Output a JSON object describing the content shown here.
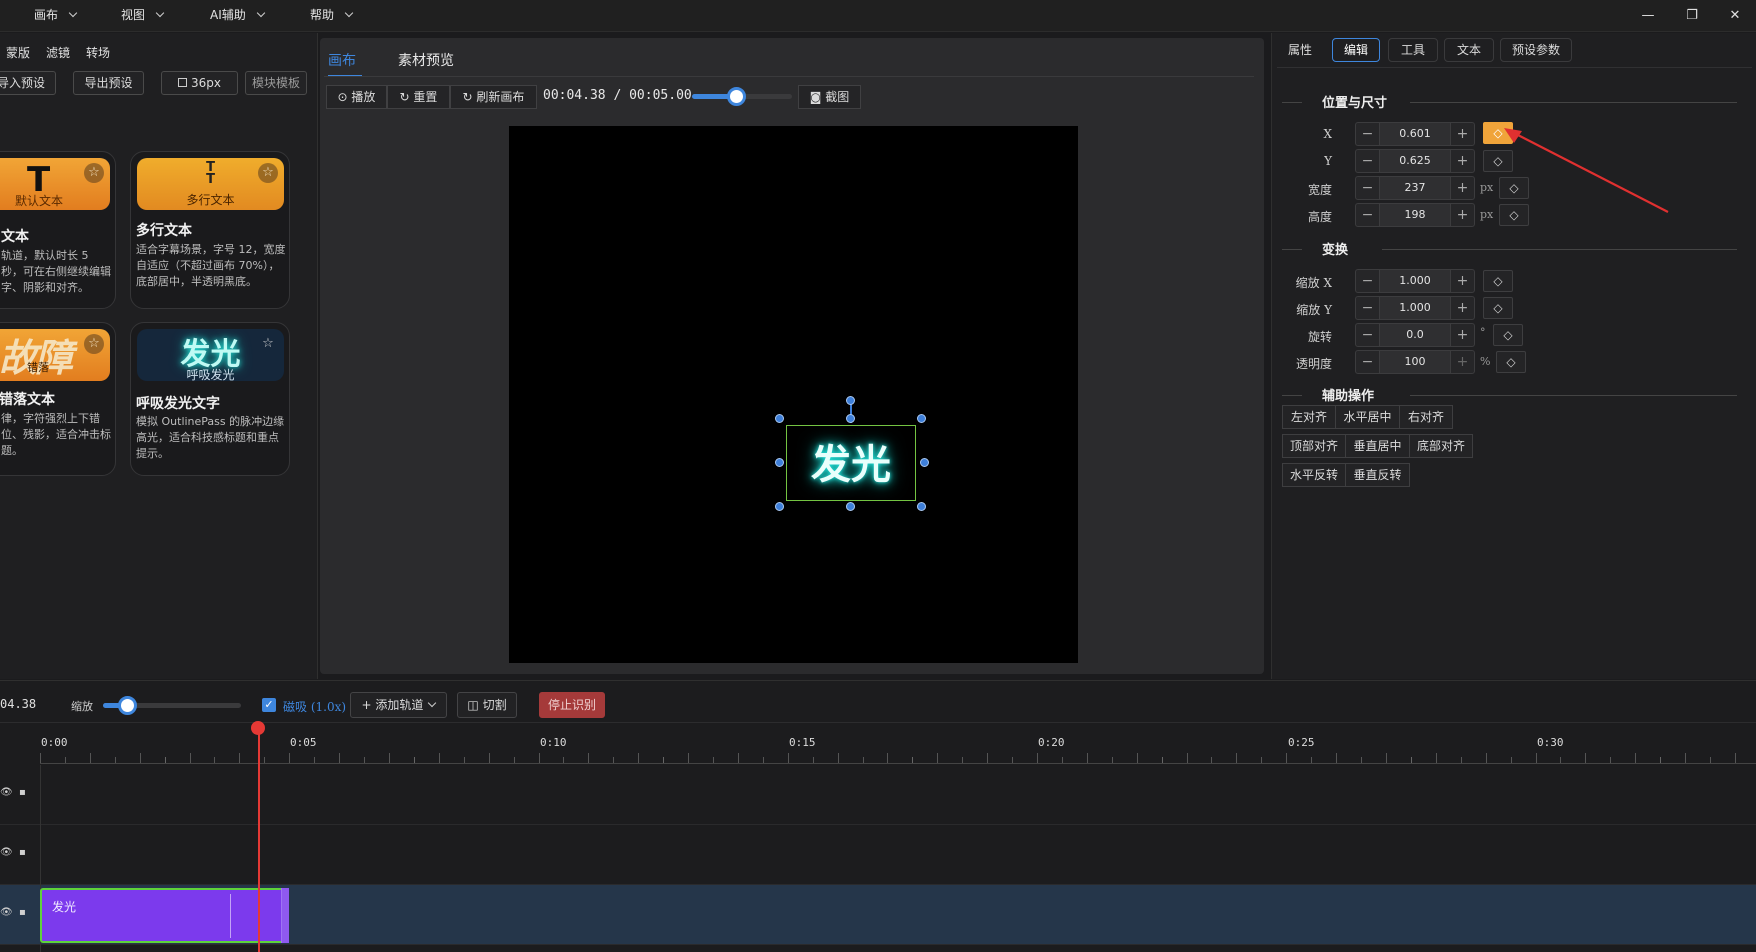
{
  "menu": [
    {
      "label": "画布"
    },
    {
      "label": "视图"
    },
    {
      "label": "AI辅助"
    },
    {
      "label": "帮助"
    }
  ],
  "window_controls": {
    "minimize": "—",
    "restore": "❐",
    "close": "✕"
  },
  "left_panel": {
    "tabs": [
      "蒙版",
      "滤镜",
      "转场"
    ],
    "import_preset": "导入预设",
    "export_preset": "导出预设",
    "font_size": "36px",
    "module_template": "模块模板",
    "cards": [
      {
        "thumb_text": "T",
        "thumb_label": "默认文本",
        "title": "文本",
        "desc": "轨道，默认时长 5 秒，可在右侧继续编辑字、阴影和对齐。"
      },
      {
        "thumb_text": "T",
        "thumb_label": "多行文本",
        "title": "多行文本",
        "desc": "适合字幕场景，字号 12，宽度自适应（不超过画布 70%），底部居中，半透明黑底。"
      },
      {
        "thumb_text": "故障",
        "thumb_label": "错落",
        "title": "错落文本",
        "desc": "律，字符强烈上下错位、残影，适合冲击标题。"
      },
      {
        "thumb_text": "发光",
        "thumb_label": "呼吸发光",
        "title": "呼吸发光文字",
        "desc": "模拟 OutlinePass 的脉冲边缘高光，适合科技感标题和重点提示。"
      }
    ]
  },
  "canvas": {
    "tabs": [
      "画布",
      "素材预览"
    ],
    "active_tab": "画布",
    "play": "播放",
    "reset": "重置",
    "refresh": "刷新画布",
    "current_time": "00:04.38",
    "separator": "/",
    "total_time": "00:05.00",
    "progress": 0.445,
    "screenshot": "截图",
    "stage_text": "发光"
  },
  "right_panel": {
    "tabs": [
      "属性",
      "编辑",
      "工具",
      "文本",
      "预设参数"
    ],
    "active_tab": "编辑",
    "pos_section": "位置与尺寸",
    "transform_section": "变换",
    "assist_section": "辅助操作",
    "fields": {
      "x": {
        "label": "X",
        "value": "0.601"
      },
      "y": {
        "label": "Y",
        "value": "0.625"
      },
      "width": {
        "label": "宽度",
        "value": "237",
        "unit": "px"
      },
      "height": {
        "label": "高度",
        "value": "198",
        "unit": "px"
      },
      "scale_x": {
        "label": "缩放 X",
        "value": "1.000"
      },
      "scale_y": {
        "label": "缩放 Y",
        "value": "1.000"
      },
      "rotation": {
        "label": "旋转",
        "value": "0.0",
        "unit": "°"
      },
      "opacity": {
        "label": "透明度",
        "value": "100",
        "unit": "%"
      }
    },
    "align_buttons": [
      "左对齐",
      "水平居中",
      "右对齐",
      "顶部对齐",
      "垂直居中",
      "底部对齐",
      "水平反转",
      "垂直反转"
    ],
    "minus": "−",
    "plus": "+",
    "keyframe": "◇"
  },
  "timeline": {
    "time": "04.38",
    "zoom_label": "缩放",
    "zoom_level": 0.18,
    "magnet_label": "磁吸 (1.0x)",
    "magnet_checked": true,
    "add_track": "添加轨道",
    "cut": "切割",
    "stop_recognition": "停止识别",
    "ruler": [
      "0:00",
      "0:05",
      "0:10",
      "0:15",
      "0:20",
      "0:25",
      "0:30"
    ],
    "clip_label": "发光",
    "clip_end_seconds": 5.0,
    "playhead_seconds": 4.38
  },
  "colors": {
    "accent": "#3e86dd",
    "keyframe_active": "#f0a43a",
    "clip": "#7c3aed",
    "clip_border": "#5fd23a",
    "playhead": "#e53935",
    "stop_btn": "#a53a3a",
    "annotation_arrow": "#e03030"
  }
}
